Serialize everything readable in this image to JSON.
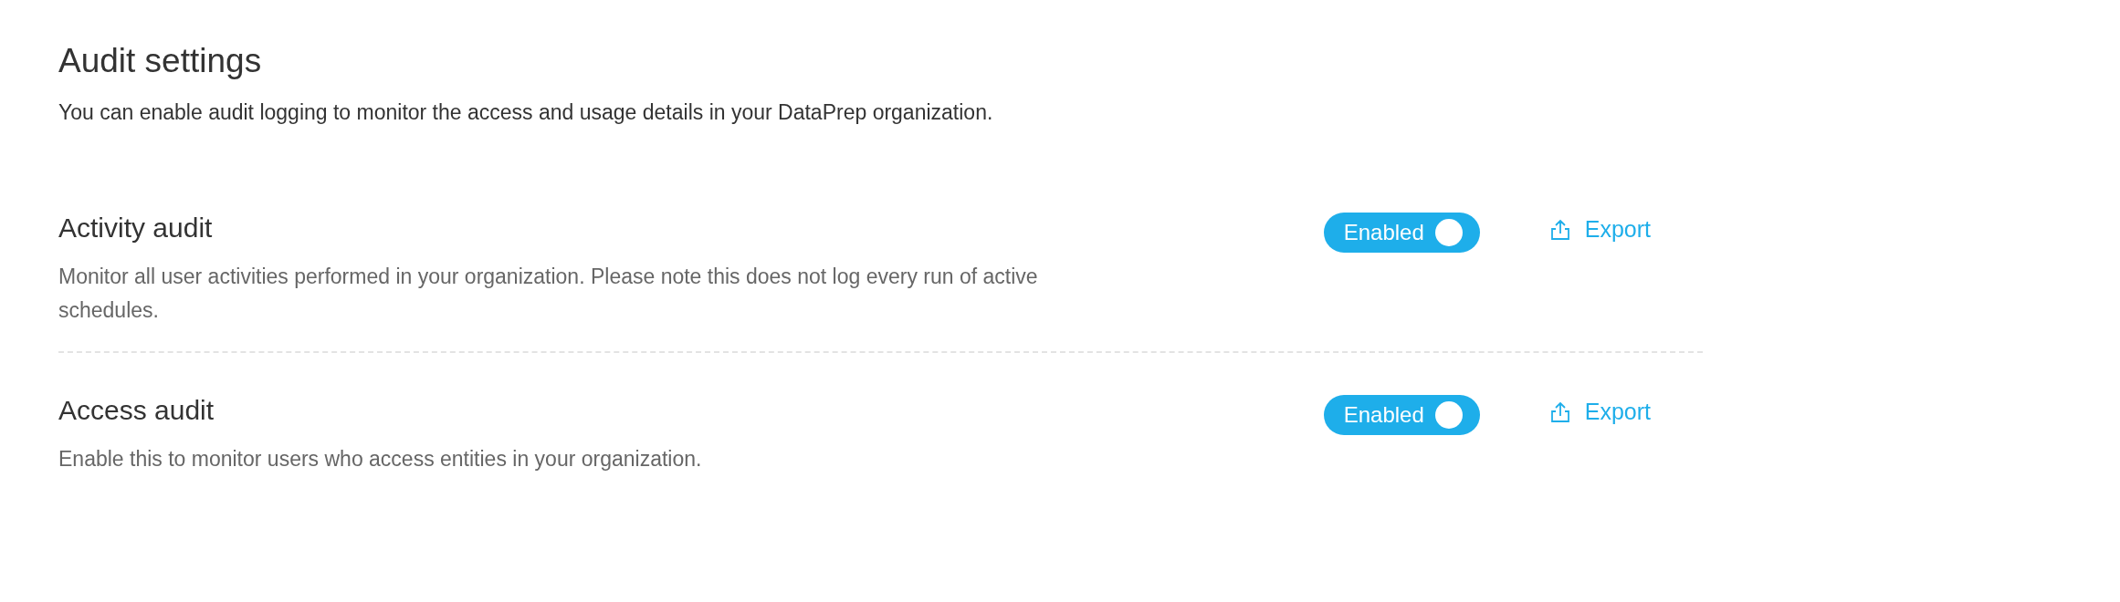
{
  "header": {
    "title": "Audit settings",
    "description": "You can enable audit logging to monitor the access and usage details in your DataPrep organization."
  },
  "sections": [
    {
      "title": "Activity audit",
      "description": "Monitor all user activities performed in your organization. Please note this does not log every run of active schedules.",
      "toggle": {
        "label": "Enabled",
        "on": true
      },
      "action": "Export"
    },
    {
      "title": "Access audit",
      "description": "Enable this to monitor users who access entities in your organization.",
      "toggle": {
        "label": "Enabled",
        "on": true
      },
      "action": "Export"
    }
  ]
}
